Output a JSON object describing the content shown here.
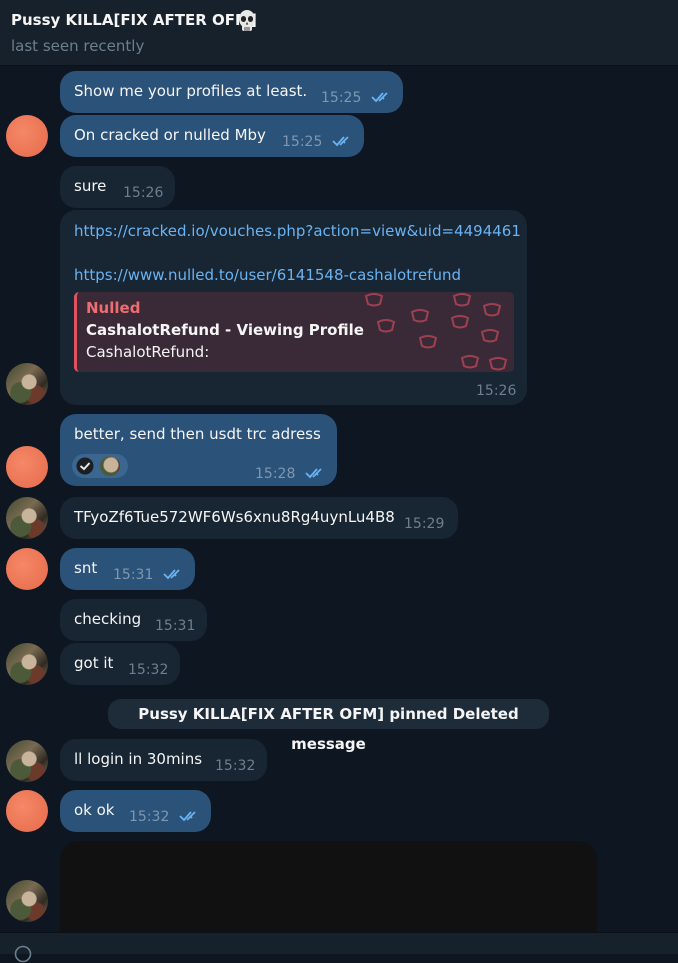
{
  "header": {
    "title": "Pussy KILLA[FIX AFTER OFM]",
    "status": "last seen recently"
  },
  "messages": [
    {
      "text": "Show me your profiles at least.",
      "time": "15:25"
    },
    {
      "text": "On cracked or nulled Mby",
      "time": "15:25"
    },
    {
      "text": "sure",
      "time": "15:26"
    },
    {
      "link1": "https://cracked.io/vouches.php?action=view&uid=4494461",
      "link2": "https://www.nulled.to/user/6141548-cashalotrefund",
      "preview_site": "Nulled",
      "preview_title": "CashalotRefund - Viewing Profile",
      "preview_desc": "CashalotRefund:",
      "time": "15:26"
    },
    {
      "text": "better, send then usdt trc adress",
      "time": "15:28"
    },
    {
      "text": "TFyoZf6Tue572WF6Ws6xnu8Rg4uynLu4B8",
      "time": "15:29"
    },
    {
      "text": "snt",
      "time": "15:31"
    },
    {
      "text": "checking",
      "time": "15:31"
    },
    {
      "text": "got it",
      "time": "15:32"
    },
    {
      "service": "Pussy KILLA[FIX AFTER OFM] pinned Deleted message"
    },
    {
      "text": "ll login in 30mins",
      "time": "15:32"
    },
    {
      "text": "ok ok",
      "time": "15:32"
    }
  ],
  "colors": {
    "background": "#0e1621",
    "outgoing_bubble": "#2b5278",
    "incoming_bubble": "#182533",
    "link": "#6ab3f3",
    "read_check": "#6ab3f3"
  },
  "icons": [
    "skull-icon",
    "double-check-icon",
    "emoji-icon"
  ]
}
